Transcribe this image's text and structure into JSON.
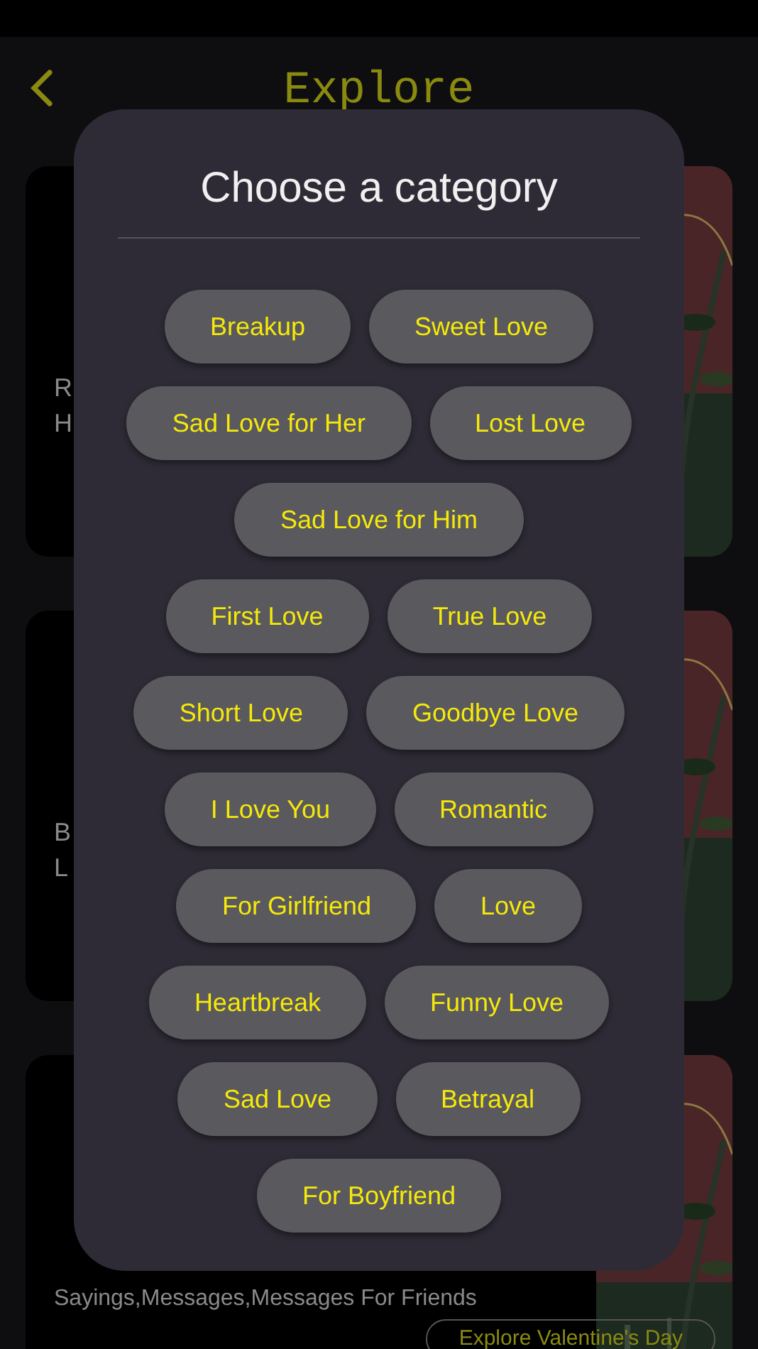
{
  "header": {
    "title": "Explore"
  },
  "cards": [
    {
      "lines": [
        "R",
        "H"
      ],
      "picture": {
        "kind": "picture"
      }
    },
    {
      "lines": [
        "B",
        "L"
      ],
      "picture": {
        "kind": "picture"
      }
    },
    {
      "subtitle": "Sayings,Messages,Messages For Friends",
      "button": "Explore Valentine's Day",
      "picture": {
        "kind": "picture"
      }
    }
  ],
  "dialog": {
    "title": "Choose a category",
    "rows": [
      [
        "Breakup",
        "Sweet Love"
      ],
      [
        "Sad Love for Her",
        "Lost Love"
      ],
      [
        "Sad Love for Him"
      ],
      [
        "First Love",
        "True Love"
      ],
      [
        "Short Love",
        "Goodbye Love"
      ],
      [
        "I Love You",
        "Romantic"
      ],
      [
        "For Girlfriend",
        "Love"
      ],
      [
        "Heartbreak",
        "Funny Love"
      ],
      [
        "Sad Love",
        "Betrayal"
      ],
      [
        "For Boyfriend"
      ]
    ]
  }
}
